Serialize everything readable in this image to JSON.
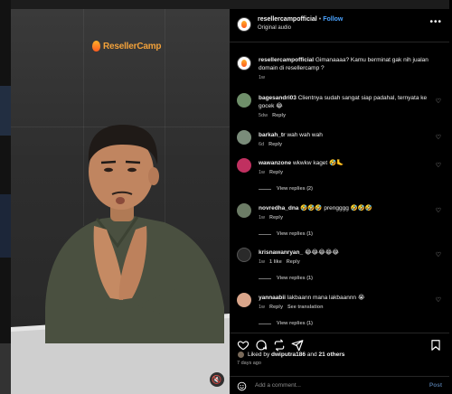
{
  "brand": {
    "logo_text": "ResellerCamp",
    "accent": "#f2a13a"
  },
  "header": {
    "username": "resellercampofficial",
    "separator": "•",
    "follow_label": "Follow",
    "subtitle": "Original audio",
    "more_icon": "ellipsis-icon"
  },
  "caption": {
    "username": "resellercampofficial",
    "text": "Gimanaaaa? Kamu berminat gak nih jualan domain di resellercamp ?",
    "time": "1w"
  },
  "comments": [
    {
      "username": "bagesandri03",
      "text": "Clientnya sudah sangat siap padahal, ternyata ke gocek 😂",
      "time": "5dw",
      "likes": "",
      "reply": "Reply",
      "translate": "",
      "view_replies": ""
    },
    {
      "username": "barkah_tr",
      "text": "wah wah wah",
      "time": "6d",
      "likes": "",
      "reply": "Reply",
      "translate": "",
      "view_replies": ""
    },
    {
      "username": "wawanzone",
      "text": "wkwkw kaget 🤣🦶",
      "time": "1w",
      "likes": "",
      "reply": "Reply",
      "translate": "",
      "view_replies": "View replies (2)"
    },
    {
      "username": "novredha_dna",
      "text": "🤣🤣🤣 prengggg 🤣🤣🤣",
      "time": "1w",
      "likes": "",
      "reply": "Reply",
      "translate": "",
      "view_replies": "View replies (1)"
    },
    {
      "username": "krisnawanryan_",
      "text": "😂😂😂😂😂",
      "time": "1w",
      "likes": "1 like",
      "reply": "Reply",
      "translate": "",
      "view_replies": "View replies (1)"
    },
    {
      "username": "yannaabii",
      "text": "lakbaann mana lakbaannn 😭",
      "time": "1w",
      "likes": "",
      "reply": "Reply",
      "translate": "See translation",
      "view_replies": "View replies (1)"
    }
  ],
  "actions": {
    "like_icon": "heart-icon",
    "comment_icon": "comment-icon",
    "share_icon": "repost-icon",
    "send_icon": "send-icon",
    "save_icon": "bookmark-icon"
  },
  "likes_line": {
    "prefix": "Liked by",
    "user": "dwiputra186",
    "conj": "and",
    "others": "21 others",
    "age": "7 days ago"
  },
  "composer": {
    "placeholder": "Add a comment...",
    "post_label": "Post",
    "emoji_icon": "smiley-icon"
  }
}
